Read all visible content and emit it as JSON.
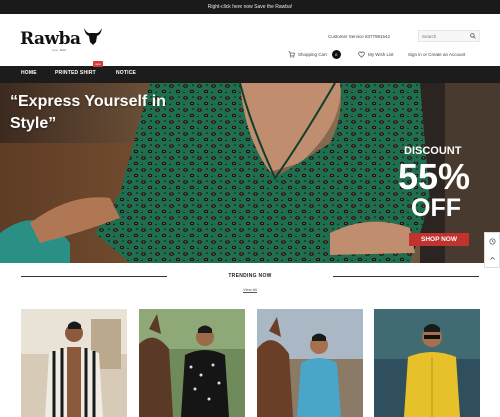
{
  "announcement": "Right-click here now Save the Rawba!",
  "logo": {
    "text": "Rawba",
    "tagline": "Live . Bold"
  },
  "header": {
    "customer_service": "Customer Service 8377981542",
    "search_placeholder": "Search",
    "cart_label": "Shopping Cart",
    "cart_count": "0",
    "wishlist_label": "My Wish List",
    "account_label": "Sign in or Create an Account"
  },
  "nav": {
    "items": [
      {
        "label": "HOME"
      },
      {
        "label": "PRINTED SHIRT"
      },
      {
        "label": "NOTICE"
      }
    ],
    "badge": "new"
  },
  "hero": {
    "title": "“Express Yourself in Style”",
    "discount_label": "DISCOUNT",
    "discount_value": "55%",
    "discount_off": "OFF",
    "cta_label": "SHOP NOW",
    "colors": {
      "shirt": "#1f6e4f",
      "cta": "#c0332f"
    }
  },
  "trending": {
    "title": "TRENDING NOW",
    "view_all": "View All"
  },
  "products": [
    {
      "name": "striped-shirt",
      "color": "#222222"
    },
    {
      "name": "black-printed-shirt",
      "color": "#1a1a1a"
    },
    {
      "name": "blue-shirt",
      "color": "#4aa6c9"
    },
    {
      "name": "yellow-shirt",
      "color": "#e7c12a"
    }
  ]
}
